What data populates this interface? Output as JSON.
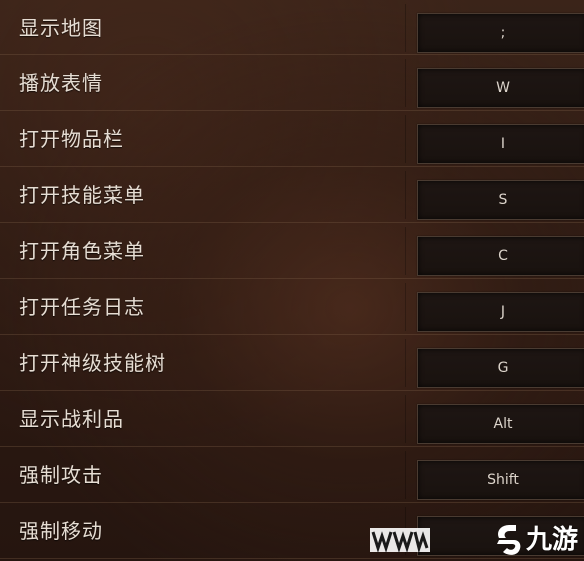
{
  "keybindings": [
    {
      "action": "显示地图",
      "key": ";"
    },
    {
      "action": "播放表情",
      "key": "W"
    },
    {
      "action": "打开物品栏",
      "key": "I"
    },
    {
      "action": "打开技能菜单",
      "key": "S"
    },
    {
      "action": "打开角色菜单",
      "key": "C"
    },
    {
      "action": "打开任务日志",
      "key": "J"
    },
    {
      "action": "打开神级技能树",
      "key": "G"
    },
    {
      "action": "显示战利品",
      "key": "Alt"
    },
    {
      "action": "强制攻击",
      "key": "Shift"
    },
    {
      "action": "强制移动",
      "key": ""
    }
  ],
  "watermark": {
    "brand_text": "九游",
    "prefix_text": "WW"
  },
  "colors": {
    "background": "#2e1b13",
    "label_text": "#e6ddd3",
    "keybox_bg": "#1b1310",
    "keybox_border": "#4a3b31"
  }
}
